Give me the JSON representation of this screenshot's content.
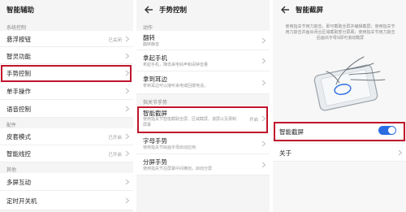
{
  "panel1": {
    "title": "智能辅助",
    "section_system": "系统控制",
    "items": [
      {
        "label": "悬浮按钮",
        "status": "已关闭"
      },
      {
        "label": "智灵功能",
        "status": ""
      },
      {
        "label": "手势控制",
        "status": ""
      },
      {
        "label": "单手操作",
        "status": ""
      },
      {
        "label": "语音控制",
        "status": ""
      }
    ],
    "section_accessories": "配件",
    "accessories": [
      {
        "label": "皮套模式",
        "status": "已开启"
      },
      {
        "label": "智能线控",
        "status": "已开启"
      }
    ],
    "section_other": "其他",
    "others": [
      {
        "label": "多屏互动",
        "status": ""
      },
      {
        "label": "定时开关机",
        "status": ""
      }
    ]
  },
  "panel2": {
    "title": "手势控制",
    "section_actions": "动作",
    "actions": [
      {
        "label": "翻转",
        "sub": "翻转静音"
      },
      {
        "label": "拿起手机",
        "sub": "拿起手机，降低来电铃声和闹钟音量"
      },
      {
        "label": "拿到耳边",
        "sub": "拿到耳边可以接听来电或回拨电话，"
      }
    ],
    "section_knuckle": "指关节手势",
    "knuckle": [
      {
        "label": "智能截屏",
        "sub1": "使用指关节智能截取全屏、区域截屏、滚屏以及录制屏幕",
        "status": "开启"
      },
      {
        "label": "字母手势",
        "sub1": "使用指关节绘画字母启动应用",
        "status": ""
      },
      {
        "label": "分屏手势",
        "sub1": "使用指关节在屏幕中间横划，启动分屏",
        "status": ""
      }
    ]
  },
  "panel3": {
    "title": "智能截屏",
    "description": "使用指关节用力敲击，即可截取全屏并编辑截屏；使用指关节用力敲击并画出闭合区域截取部分屏幕；使用指关节用力敲击后画出字母S即可滚动截屏",
    "toggle_label": "智能截屏",
    "toggle_on": true,
    "about_label": "关于"
  },
  "colors": {
    "accent": "#2a6de0",
    "highlight": "#c0142b"
  },
  "icons": {
    "back": "back-arrow-icon",
    "chevron": "chevron-right-icon"
  }
}
